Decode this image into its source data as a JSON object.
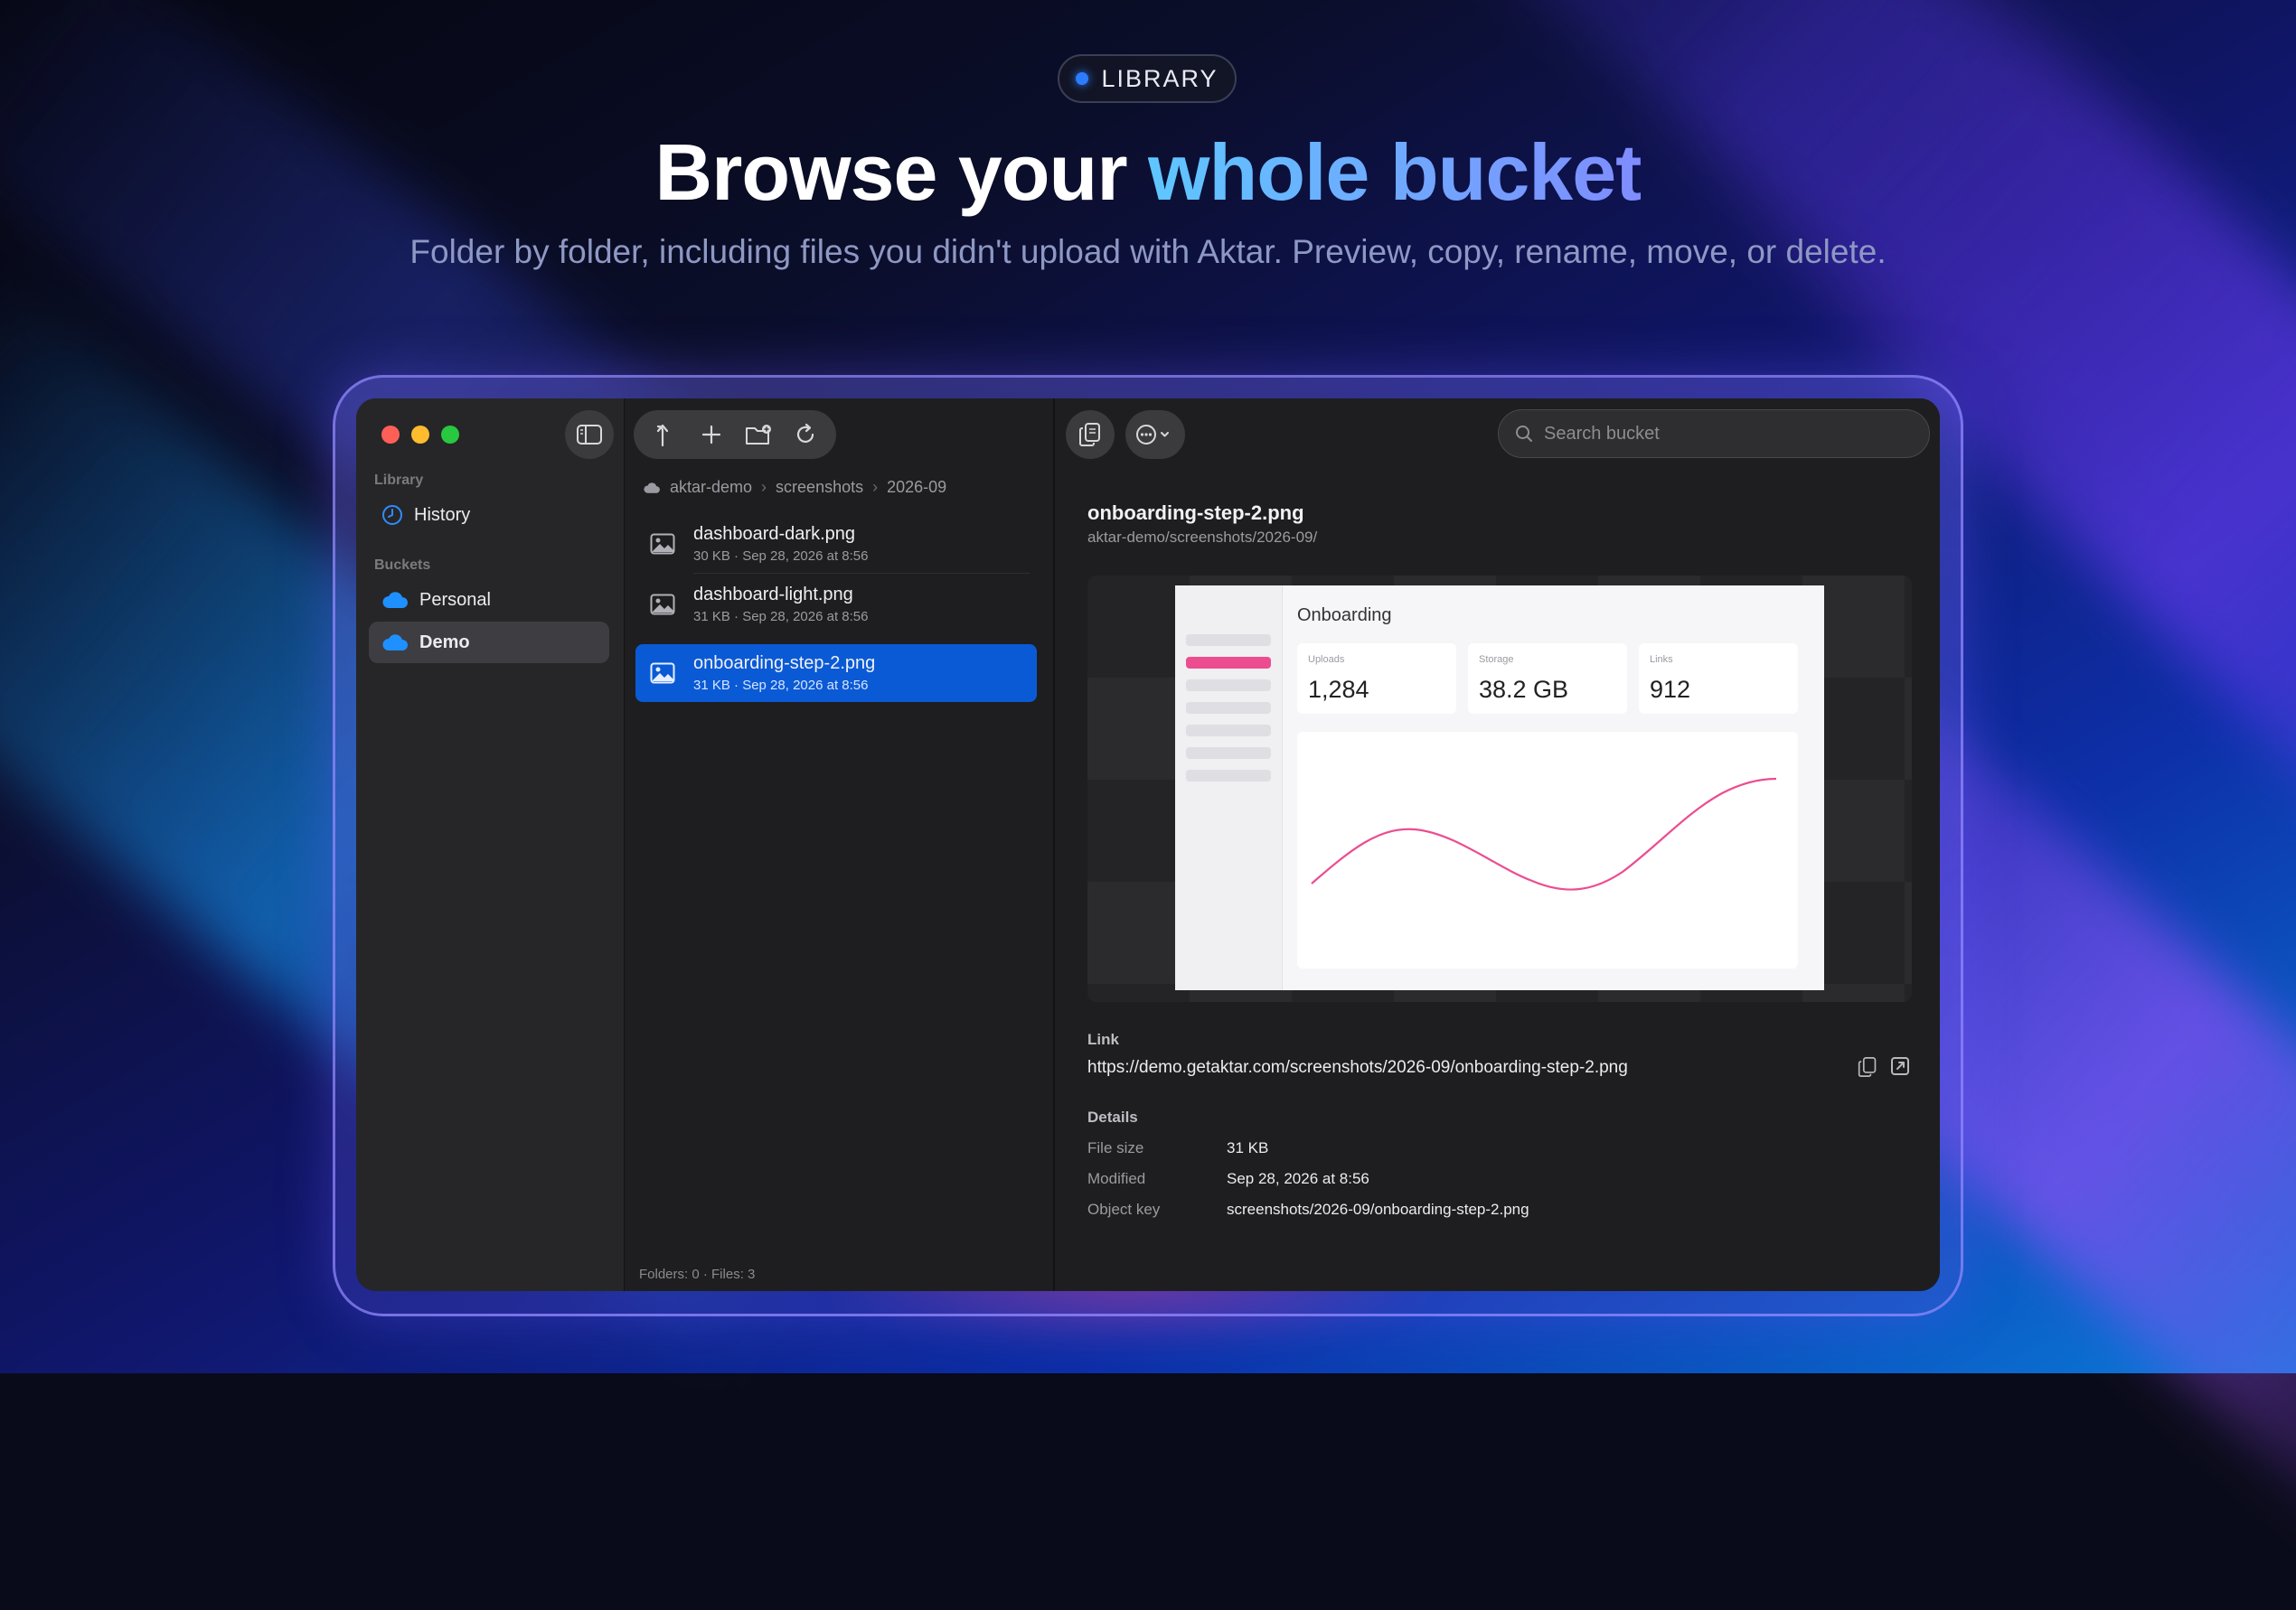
{
  "hero": {
    "badge": "LIBRARY",
    "headline_plain": "Browse your ",
    "headline_accent": "whole bucket",
    "subheadline": "Folder by folder, including files you didn't upload with Aktar. Preview, copy, rename, move, or delete."
  },
  "colors": {
    "accent_blue": "#0a5ad6",
    "cloud_blue": "#1e90ff",
    "chart_pink": "#ec4d8f",
    "traffic_red": "#ff5f57",
    "traffic_yellow": "#febc2e",
    "traffic_green": "#28c840"
  },
  "sidebar": {
    "toggle_icon": "sidebar-toggle-icon",
    "library_label": "Library",
    "history_label": "History",
    "buckets_label": "Buckets",
    "buckets": [
      {
        "label": "Personal",
        "icon": "cloud-icon",
        "active": false
      },
      {
        "label": "Demo",
        "icon": "cloud-icon",
        "active": true
      }
    ]
  },
  "browser": {
    "toolbar_icons": [
      "go-up-icon",
      "plus-icon",
      "new-folder-icon",
      "refresh-icon"
    ],
    "breadcrumb": [
      "aktar-demo",
      "screenshots",
      "2026-09"
    ],
    "files": [
      {
        "name": "dashboard-dark.png",
        "meta": "30 KB · Sep 28, 2026 at 8:56",
        "selected": false
      },
      {
        "name": "dashboard-light.png",
        "meta": "31 KB · Sep 28, 2026 at 8:56",
        "selected": false
      },
      {
        "name": "onboarding-step-2.png",
        "meta": "31 KB · Sep 28, 2026 at 8:56",
        "selected": true
      }
    ],
    "footer": "Folders: 0 · Files: 3"
  },
  "detail": {
    "search_placeholder": "Search bucket",
    "file_name": "onboarding-step-2.png",
    "file_path": "aktar-demo/screenshots/2026-09/",
    "preview": {
      "title": "Onboarding",
      "stats": [
        {
          "label": "Uploads",
          "value": "1,284"
        },
        {
          "label": "Storage",
          "value": "38.2 GB"
        },
        {
          "label": "Links",
          "value": "912"
        }
      ]
    },
    "link_label": "Link",
    "link_url": "https://demo.getaktar.com/screenshots/2026-09/onboarding-step-2.png",
    "details_label": "Details",
    "details": [
      {
        "key": "File size",
        "value": "31 KB"
      },
      {
        "key": "Modified",
        "value": "Sep 28, 2026 at 8:56"
      },
      {
        "key": "Object key",
        "value": "screenshots/2026-09/onboarding-step-2.png"
      }
    ]
  }
}
